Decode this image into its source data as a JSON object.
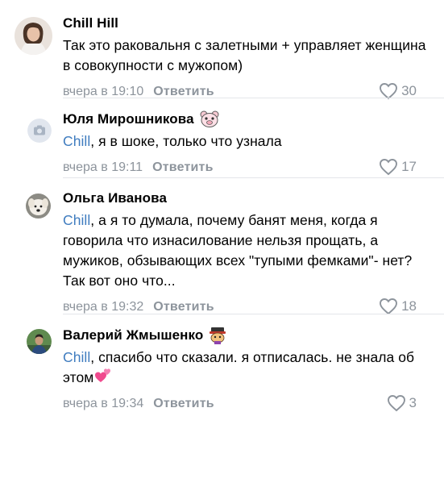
{
  "comments": [
    {
      "author": "Chill Hill",
      "text_parts": [
        "Так это раковальня с залетными + управляет женщина в совокупности с мужопом)"
      ],
      "mention": "",
      "time": "вчера в 19:10",
      "reply_label": "Ответить",
      "likes": "30",
      "avatar_icon": "female-photo-avatar",
      "name_emoji": ""
    },
    {
      "author": "Юля Мирошникова",
      "mention": "Chill",
      "text": ", я в шоке, только что узнала",
      "time": "вчера в 19:11",
      "reply_label": "Ответить",
      "likes": "17",
      "avatar_icon": "camera-placeholder-avatar",
      "name_emoji": "pig-face-emoji"
    },
    {
      "author": "Ольга Иванова",
      "mention": "Chill",
      "text": ", а я то думала, почему банят меня, когда я говорила что изнасилование нельзя прощать, а мужиков, обзывающих всех \"тупыми фемками\"- нет? Так вот оно что...",
      "time": "вчера в 19:32",
      "reply_label": "Ответить",
      "likes": "18",
      "avatar_icon": "dog-photo-avatar",
      "name_emoji": ""
    },
    {
      "author": "Валерий Жмышенко",
      "mention": "Chill",
      "text": ", спасибо что сказали. я отписалась. не знала об этом",
      "time": "вчера в 19:34",
      "reply_label": "Ответить",
      "likes": "3",
      "avatar_icon": "male-photo-avatar",
      "name_emoji": "sticker-emoji",
      "text_end_emoji": "two-hearts-emoji"
    }
  ],
  "colors": {
    "mention": "#3f7cbf",
    "meta": "#8d949c",
    "divider": "#e4e6ea"
  }
}
